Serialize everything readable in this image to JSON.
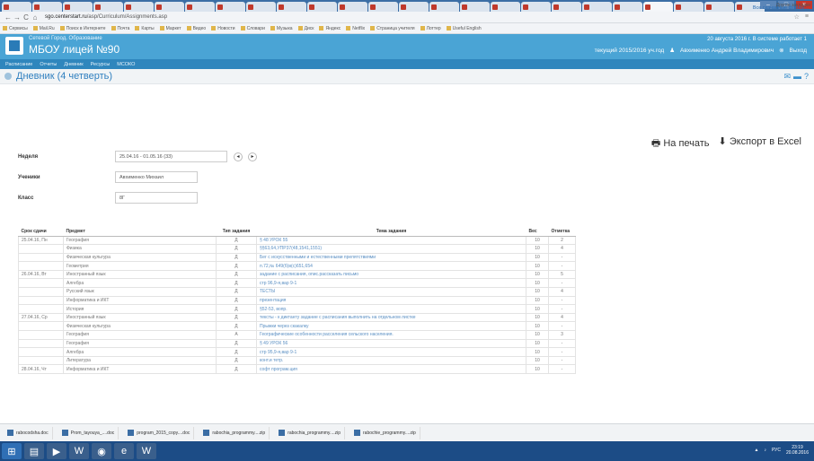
{
  "browser": {
    "tabs": [
      "",
      "",
      "",
      "",
      "",
      "",
      "",
      "",
      "",
      "",
      "",
      "",
      "",
      "",
      "",
      "",
      "",
      "",
      "",
      "",
      "",
      "",
      "",
      "",
      ""
    ],
    "url_host": "sgo.centerstart.ru",
    "url_path": "/asp/Curriculum/Assignments.asp",
    "bookmarks": [
      "Сервисы",
      "Mail.Ru",
      "Поиск в Интернете",
      "Почта",
      "Карты",
      "Маркет",
      "Видео",
      "Новости",
      "Словари",
      "Музыка",
      "Диск",
      "Яндекс",
      "Netflix",
      "Страница учителя",
      "Лоттер",
      "Useful English"
    ],
    "bookmarks_right": "Другие закладки"
  },
  "site": {
    "subtitle": "Сетевой Город. Образование",
    "title": "МБОУ лицей №90",
    "date_line": "20 августа 2016 г.  В системе работает 1",
    "year": "текущий 2015/2016 уч.год",
    "user": "Авхименко Андрей Владимирович",
    "logout": "Выход"
  },
  "menu": [
    "Расписание",
    "Отчеты",
    "Дневник",
    "Ресурсы",
    "МСОКО"
  ],
  "page": {
    "title": "Дневник (4 четверть)",
    "print_label": "На печать",
    "export_label": "Экспорт в Excel"
  },
  "form": {
    "week_label": "Неделя",
    "week_value": "25.04.16 - 01.05.16 (33)",
    "student_label": "Ученики",
    "student_value": "Авхименко Михаил",
    "class_label": "Класс",
    "class_value": "8Г"
  },
  "table": {
    "headers": [
      "Срок сдачи",
      "Предмет",
      "Тип задания",
      "Тема задания",
      "Вес",
      "Отметка"
    ],
    "rows": [
      [
        "25.04.16, Пн",
        "География",
        "Д",
        "§ 48 УРОК 55",
        "10",
        "2"
      ],
      [
        "",
        "Физика",
        "Д",
        "§§63,64,УПР37(48,1541,1551)",
        "10",
        "4"
      ],
      [
        "",
        "Физическая культура",
        "Д",
        "Бег с искусственными и естественными препятствиями",
        "10",
        "-"
      ],
      [
        "",
        "Геометрия",
        "Д",
        "п.72,№ 649(б)в(с)651,654",
        "10",
        "-"
      ],
      [
        "26.04.16, Вт",
        "Иностранный язык",
        "Д",
        "задание с расписания, опис.рассказать письмо",
        "10",
        "5"
      ],
      [
        "",
        "Алгебра",
        "Д",
        "стр 96,9-я,вар 9-1",
        "10",
        "-"
      ],
      [
        "",
        "Русский язык",
        "Д",
        "ТЕСТЫ",
        "10",
        "4"
      ],
      [
        "",
        "Информатика и ИКТ",
        "Д",
        "презентация",
        "10",
        "-"
      ],
      [
        "",
        "История",
        "Д",
        "§52-53, вопр.",
        "10",
        "-"
      ],
      [
        "27.04.16, Ср",
        "Иностранный язык",
        "Д",
        "тексты - к диктанту задание с расписания выполнить на отдельном листке",
        "10",
        "4"
      ],
      [
        "",
        "Физическая культура",
        "Д",
        "Прыжки через скакалку",
        "10",
        "-"
      ],
      [
        "",
        "География",
        "А",
        "Географические особенности расселения сельского населения.",
        "10",
        "3"
      ],
      [
        "",
        "География",
        "Д",
        "§ 49 УРОК 56",
        "10",
        "-"
      ],
      [
        "",
        "Алгебра",
        "Д",
        "стр 95,9-я,вар 9-1",
        "10",
        "-"
      ],
      [
        "",
        "Литература",
        "Д",
        "конт.и тетр.",
        "10",
        "-"
      ],
      [
        "28.04.16, Чт",
        "Информатика и ИКТ",
        "Д",
        "софт програм.ция",
        "10",
        "-"
      ]
    ]
  },
  "downloads": {
    "items": [
      "rabocodsha.doc",
      "Prom_tayouya_....doc",
      "program_2015_copy....doc",
      "rabochia_programmy....zip",
      "rabochia_programmy....zip",
      "rabochie_programmy....zip"
    ],
    "show_all": "Все скачанные файлы..."
  },
  "taskbar": {
    "lang": "РУС",
    "time": "23:19",
    "date": "20.08.2016"
  }
}
